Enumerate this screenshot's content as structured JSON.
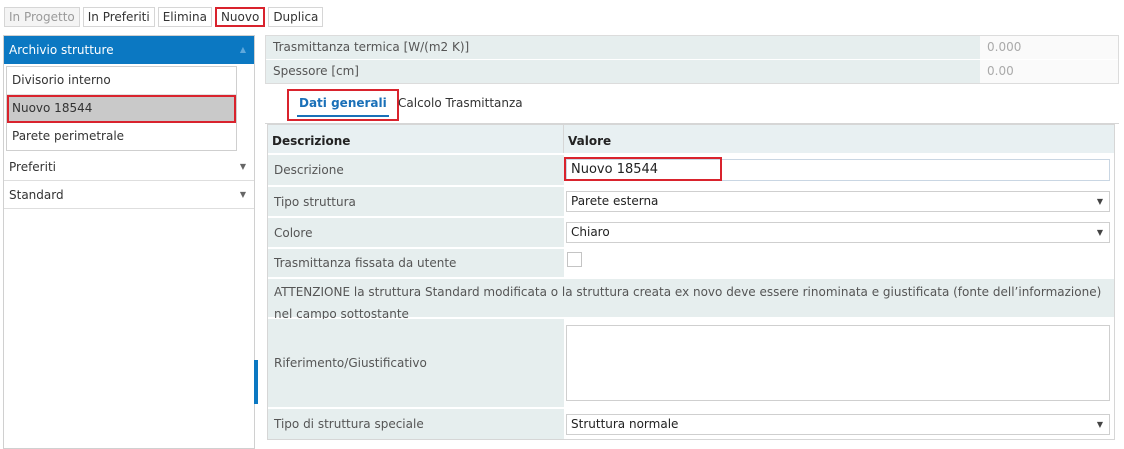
{
  "toolbar": {
    "in_progetto": "In Progetto",
    "in_preferiti": "In Preferiti",
    "elimina": "Elimina",
    "nuovo": "Nuovo",
    "duplica": "Duplica"
  },
  "sidebar": {
    "archivio_label": "Archivio strutture",
    "items": [
      "Divisorio interno",
      "Nuovo 18544",
      "Parete perimetrale"
    ],
    "preferiti_label": "Preferiti",
    "standard_label": "Standard"
  },
  "props": {
    "trasmittanza_label": "Trasmittanza termica [W/(m2 K)]",
    "trasmittanza_value": "0.000",
    "spessore_label": "Spessore [cm]",
    "spessore_value": "0.00"
  },
  "tabs": {
    "dati_generali": "Dati generali",
    "calcolo": "Calcolo Trasmittanza"
  },
  "grid": {
    "col_descrizione": "Descrizione",
    "col_valore": "Valore",
    "descrizione_label": "Descrizione",
    "descrizione_value": "Nuovo 18544",
    "tipo_label": "Tipo struttura",
    "tipo_value": "Parete esterna",
    "colore_label": "Colore",
    "colore_value": "Chiaro",
    "trasm_fissata_label": "Trasmittanza fissata da utente",
    "attenzione_text": "ATTENZIONE la struttura Standard modificata o la struttura creata ex novo deve essere rinominata e giustificata (fonte dell’informazione) nel campo sottostante",
    "riferimento_label": "Riferimento/Giustificativo",
    "speciale_label": "Tipo di struttura speciale",
    "speciale_value": "Struttura normale"
  },
  "colors": {
    "accent": "#0b78c2",
    "highlight": "#d9232d"
  }
}
